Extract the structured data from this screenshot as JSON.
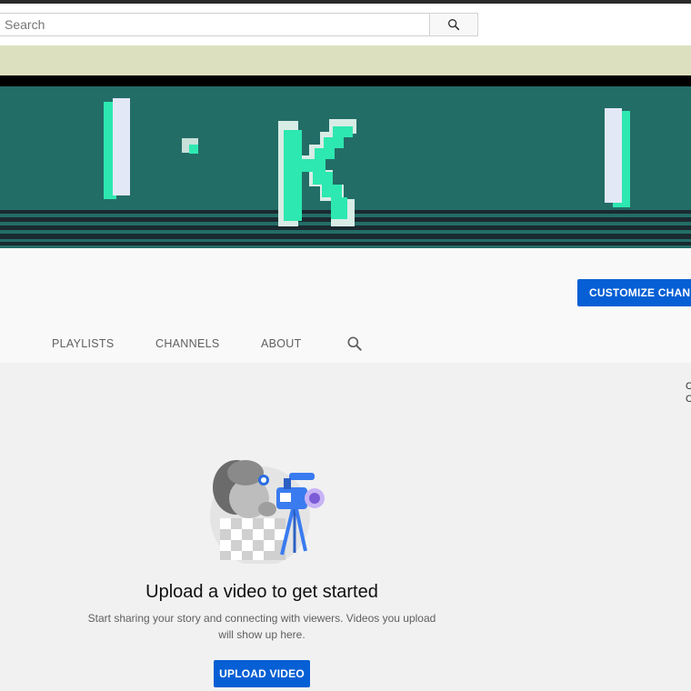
{
  "search": {
    "placeholder": "Search"
  },
  "icons": {
    "search": "search-icon",
    "tab_search": "search-icon"
  },
  "colors": {
    "accent": "#065fd4",
    "banner_teal": "#236d67",
    "banner_top": "#dde0be",
    "glyph_mint": "#2de8b0"
  },
  "banner": {
    "letter": "K"
  },
  "channel": {
    "customize_label": "CUSTOMIZE CHANNEL"
  },
  "tabs": [
    {
      "label": "PLAYLISTS"
    },
    {
      "label": "CHANNELS"
    },
    {
      "label": "ABOUT"
    }
  ],
  "empty_state": {
    "title": "Upload a video to get started",
    "subtitle": "Start sharing your story and connecting with viewers. Videos you upload will show up here.",
    "upload_label": "UPLOAD VIDEO"
  },
  "edge": {
    "right_top": "C",
    "right_bottom": "C"
  }
}
